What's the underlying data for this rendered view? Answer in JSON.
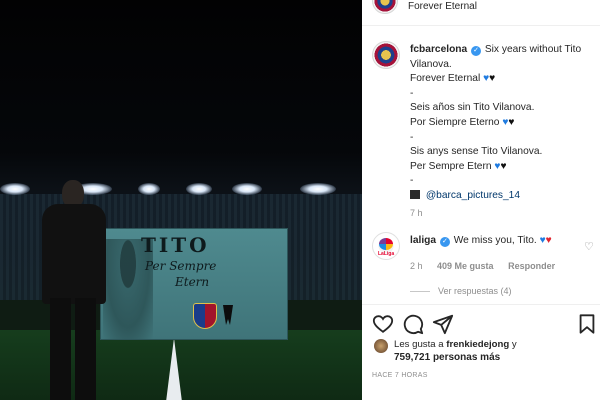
{
  "post": {
    "image_alt": "Stadium tribute banner",
    "banner": {
      "line1": "TITO",
      "line2": "Per Sempre",
      "line3": "Etern"
    },
    "top_strip_text": "Forever Eternal",
    "author": "fcbarcelona",
    "caption_lines": [
      "Six years without Tito",
      "Vilanova.",
      "Forever Eternal",
      "-",
      "Seis años sin Tito Vilanova.",
      "Por Siempre Eterno",
      "-",
      "Sis anys sense Tito Vilanova.",
      "Per Sempre Etern",
      "-"
    ],
    "mention": "@barca_pictures_14",
    "caption_time": "7 h"
  },
  "comment": {
    "user": "laliga",
    "logo_text": "LaLiga",
    "text": "We miss you, Tito.",
    "time": "2 h",
    "likes": "409 Me gusta",
    "reply_label": "Responder",
    "view_replies": "Ver respuestas (4)"
  },
  "likes": {
    "line1_prefix": "Les gusta a",
    "liked_by": "frenkiedejong",
    "line1_suffix": "y",
    "count": "759,721",
    "line2_suffix": "personas más"
  },
  "posted_ago": "HACE 7 HORAS",
  "icons": [
    "heart-icon",
    "comment-icon",
    "share-icon",
    "bookmark-icon",
    "verified-badge-icon"
  ],
  "colors": {
    "verified": "#3897f0",
    "heart_blue": "#1f7be0",
    "heart_red": "#e0242f",
    "link": "#00376b"
  }
}
